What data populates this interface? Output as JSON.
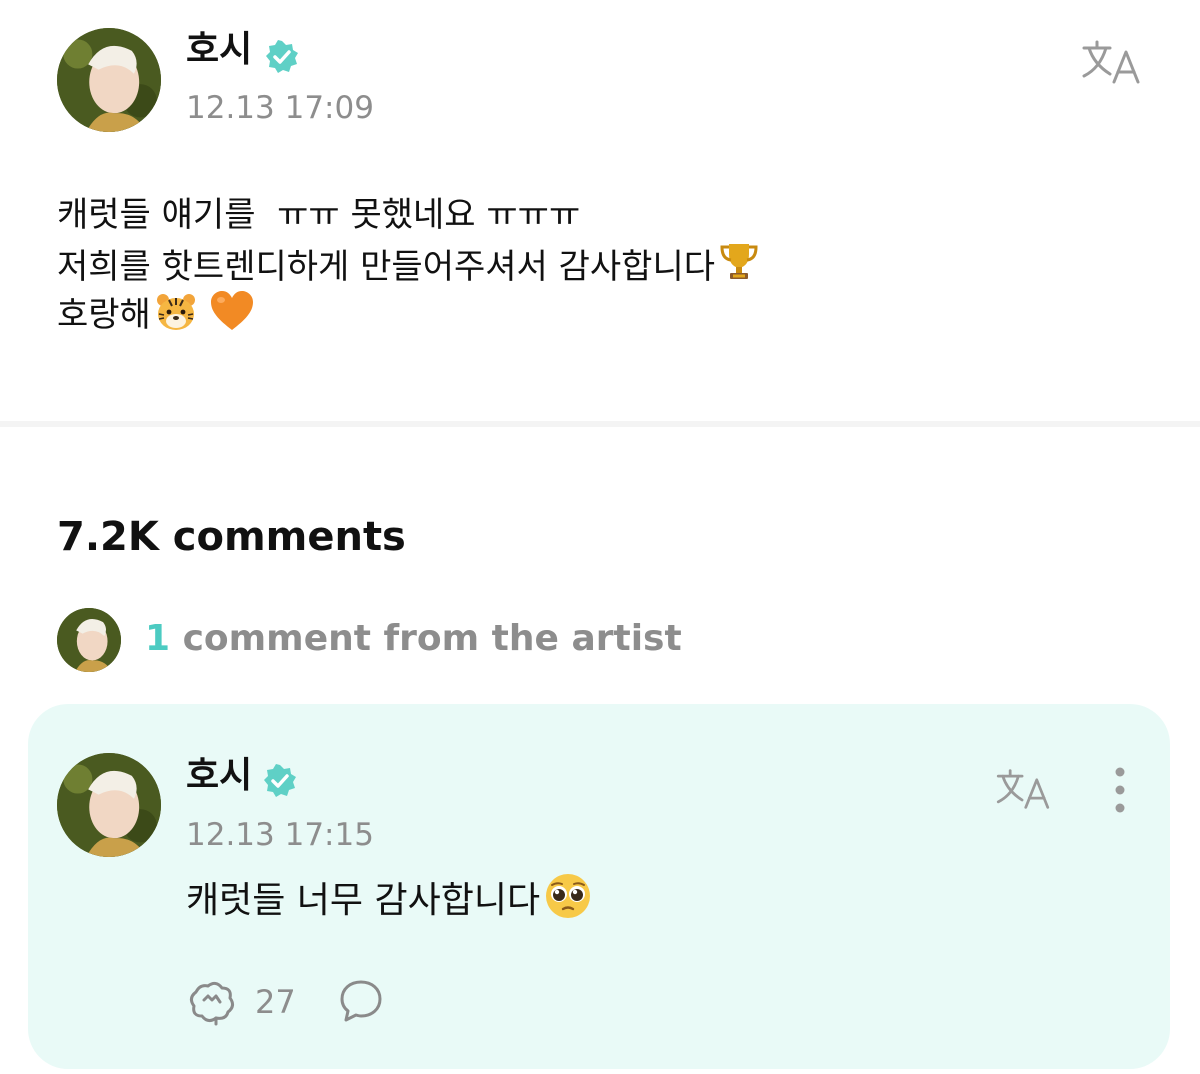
{
  "post": {
    "author": "호시",
    "timestamp": "12.13 17:09",
    "lines": [
      "캐럿들 얘기를  ㅠㅠ 못했네요 ㅠㅠㅠ",
      "저희를 핫트렌디하게 만들어주셔서 감사합니다",
      "호랑해"
    ],
    "emojis": [
      "trophy",
      "tiger-face",
      "orange-heart"
    ]
  },
  "comments": {
    "count_label": "7.2K comments",
    "artist_comment_count": "1",
    "artist_comment_label": " comment from the artist"
  },
  "artist_comment": {
    "author": "호시",
    "timestamp": "12.13 17:15",
    "text": "캐럿들 너무 감사합니다",
    "emoji": "pleading-face",
    "reaction_count": "27"
  },
  "colors": {
    "accent": "#4ccbc2",
    "card_background": "#e9faf7",
    "muted_text": "#8d8d8d"
  }
}
